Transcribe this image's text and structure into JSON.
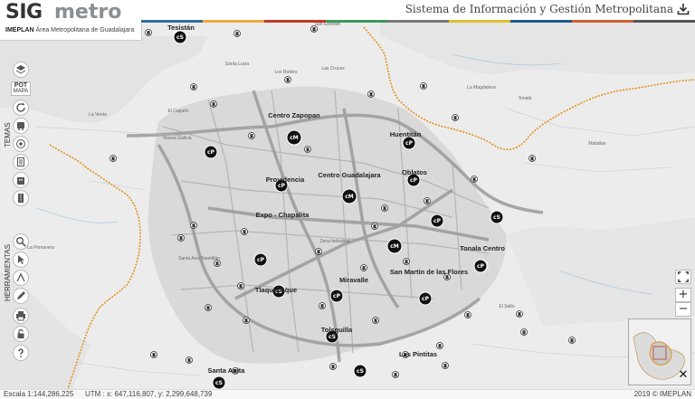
{
  "logo": {
    "sig": "SIG",
    "metro": "metro",
    "org": "IMEPLAN",
    "org_full": "Área Metropolitana de Guadalajara"
  },
  "header": {
    "title": "Sistema de Información y Gestión Metropolitana"
  },
  "colorbar": [
    "#2f6f9c",
    "#f0a93b",
    "#c0392b",
    "#3a9a5b",
    "#7a7a7a",
    "#e0c030",
    "#1d5b8a",
    "#d35f30",
    "#555555"
  ],
  "sidebar": {
    "temas_label": "TEMAS",
    "herramientas_label": "HERRAMIENTAS",
    "pot_label": "POT",
    "pot_sub": "MAPA"
  },
  "zoom": {
    "in": "+",
    "out": "−"
  },
  "status": {
    "scale": "Escala 1:144,286,225",
    "utm": "UTM : x: 647,116,807, y: 2,299,648,739",
    "copyright": "2019 © IMEPLAN"
  },
  "city_labels": [
    "Centro Zapopan",
    "Centro Guadalajara",
    "Providencia",
    "Expo - Chapalita",
    "Huentitán",
    "Oblatos",
    "Tonala Centro",
    "San Martin de las Flores",
    "Miravalle",
    "Tlaquepaque",
    "Tolsquilla",
    "Las Pintitas",
    "Santa Anita",
    "Tesistán"
  ],
  "minor_labels": [
    "Santa Lucia",
    "La Venta",
    "El Capulín",
    "Los Robles",
    "San Esteban",
    "La Magdalena",
    "Las Cruces",
    "Santa Ana Tepetitlán",
    "Nueva Galicia",
    "El Salto",
    "Matatlan",
    "La Primavera",
    "Tonalá",
    "Zona Industrial"
  ],
  "markers": [
    {
      "label": "cS"
    },
    {
      "label": "cP"
    },
    {
      "label": "cM"
    },
    {
      "label": "cP"
    },
    {
      "label": "cP"
    },
    {
      "label": "cM"
    },
    {
      "label": "cM"
    },
    {
      "label": "cP"
    },
    {
      "label": "cP"
    },
    {
      "label": "cS"
    },
    {
      "label": "cP"
    },
    {
      "label": "cP"
    },
    {
      "label": "cS"
    },
    {
      "label": "cS"
    },
    {
      "label": "cS"
    },
    {
      "label": "cS"
    },
    {
      "label": "cP"
    },
    {
      "label": "cP"
    },
    {
      "label": "cS"
    },
    {
      "label": "cP"
    }
  ],
  "e_marker": "E"
}
